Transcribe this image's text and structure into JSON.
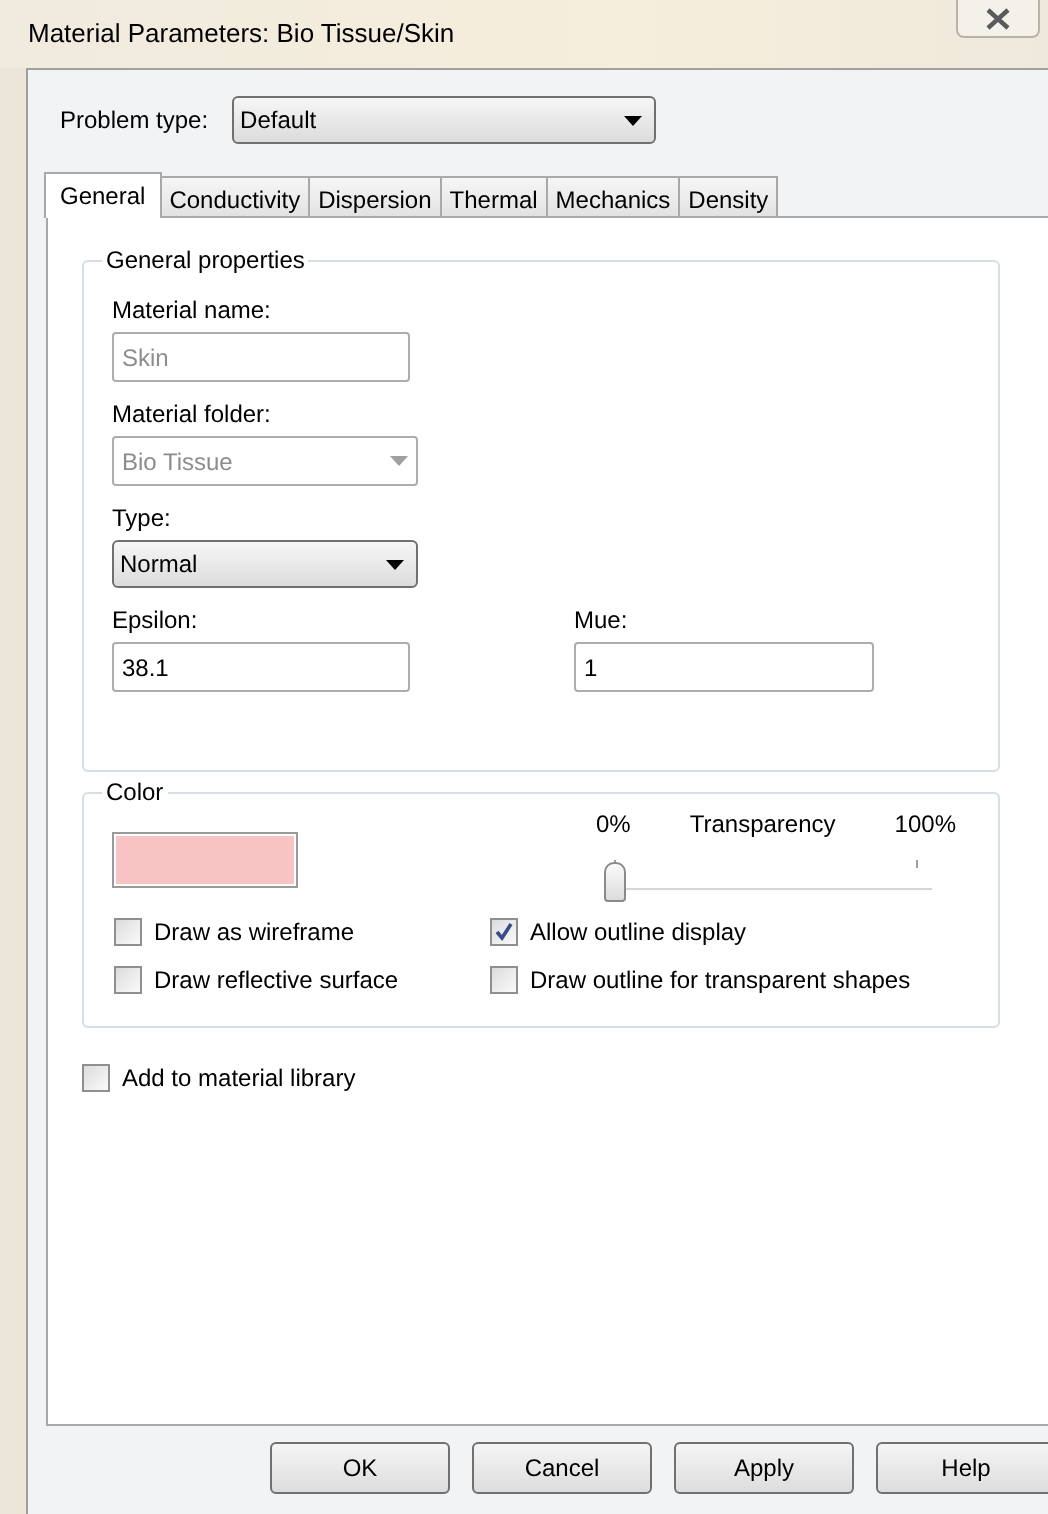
{
  "window": {
    "title": "Material Parameters: Bio Tissue/Skin"
  },
  "problem_type": {
    "label": "Problem type:",
    "value": "Default"
  },
  "tabs": [
    {
      "label": "General",
      "selected": true
    },
    {
      "label": "Conductivity",
      "selected": false
    },
    {
      "label": "Dispersion",
      "selected": false
    },
    {
      "label": "Thermal",
      "selected": false
    },
    {
      "label": "Mechanics",
      "selected": false
    },
    {
      "label": "Density",
      "selected": false
    }
  ],
  "general_properties": {
    "legend": "General properties",
    "fields": [
      {
        "kind": "text",
        "label": "Material name:",
        "value": "Skin",
        "disabled": true
      },
      {
        "kind": "select",
        "label": "Material folder:",
        "value": "Bio Tissue",
        "disabled": true
      },
      {
        "kind": "combo",
        "label": "Type:",
        "value": "Normal",
        "disabled": false
      }
    ],
    "pair": [
      {
        "label": "Epsilon:",
        "value": "38.1"
      },
      {
        "label": "Mue:",
        "value": "1"
      }
    ]
  },
  "color_group": {
    "legend": "Color",
    "swatch": {
      "color": "#f7c3c3"
    },
    "transparency": {
      "min_label": "0%",
      "label": "Transparency",
      "max_label": "100%",
      "level": 0
    },
    "checkboxes": [
      {
        "label": "Draw as wireframe",
        "checked": false
      },
      {
        "label": "Allow outline display",
        "checked": true
      },
      {
        "label": "Draw reflective surface",
        "checked": false
      },
      {
        "label": "Draw outline for transparent shapes",
        "checked": false
      }
    ]
  },
  "add_to_library": {
    "label": "Add to material library",
    "checked": false
  },
  "buttons": [
    "OK",
    "Cancel",
    "Apply",
    "Help"
  ]
}
